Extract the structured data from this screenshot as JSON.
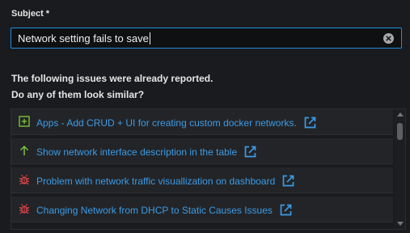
{
  "form": {
    "subject_label": "Subject *",
    "subject_value": "Network setting fails to save"
  },
  "similar": {
    "heading_line1": "The following issues were already reported.",
    "heading_line2": "Do any of them look similar?",
    "items": [
      {
        "icon": "plus-square-icon",
        "label": "Apps - Add CRUD + UI for creating custom docker networks."
      },
      {
        "icon": "arrow-up-icon",
        "label": "Show network interface description in the table"
      },
      {
        "icon": "bug-icon",
        "label": "Problem with network traffic visuallization on dashboard"
      },
      {
        "icon": "bug-icon",
        "label": "Changing Network from DHCP to Static Causes Issues"
      }
    ]
  },
  "colors": {
    "background": "#1a1b1e",
    "accent_border": "#1f8de0",
    "link": "#3b9be6",
    "feature_icon": "#7cc23b",
    "bug_icon": "#e5484d"
  }
}
